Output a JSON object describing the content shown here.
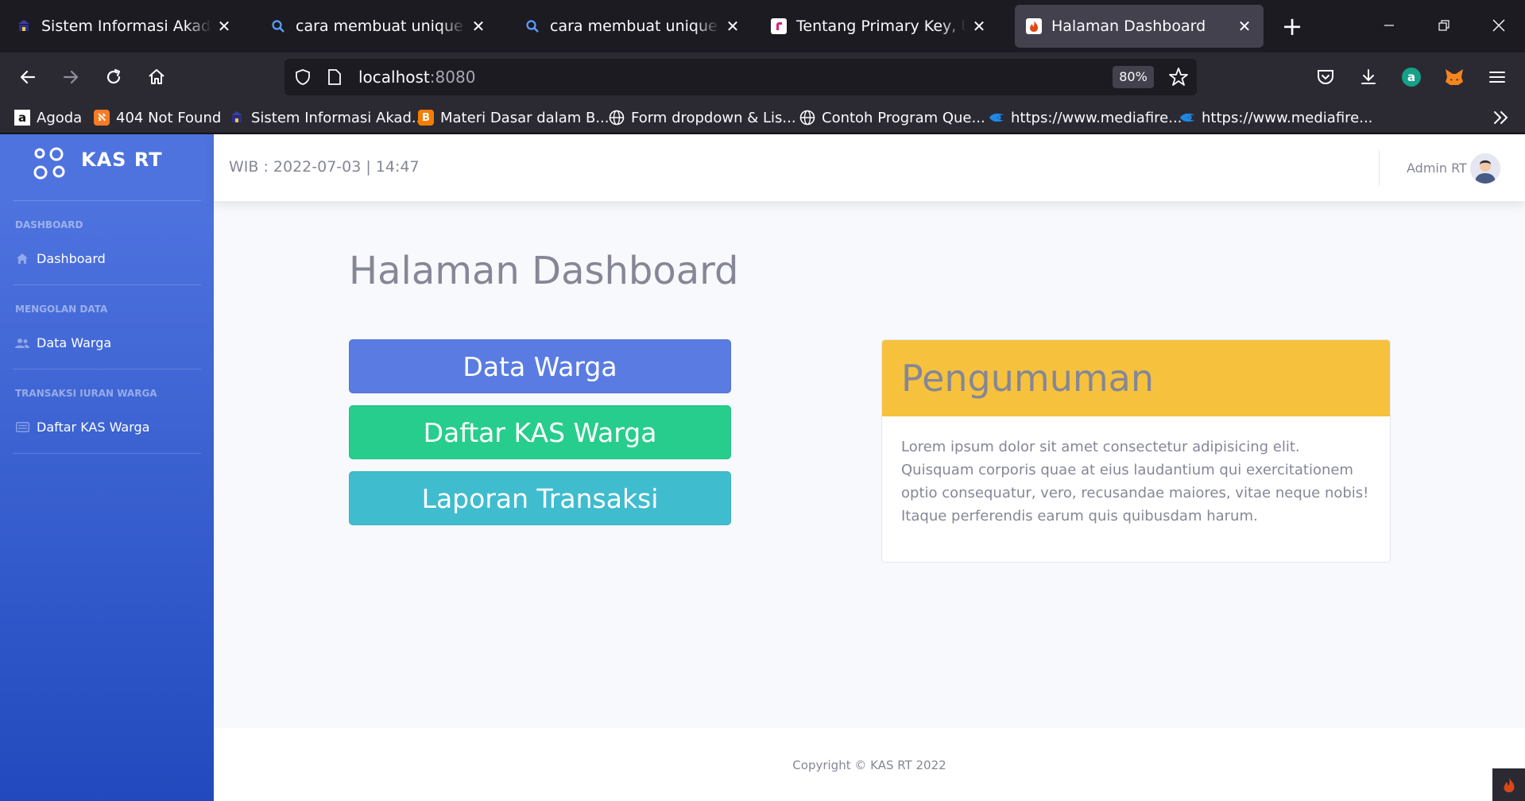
{
  "browser": {
    "tabs": [
      {
        "title": "Sistem Informasi Akademik",
        "icon": "campus-favicon",
        "active": false
      },
      {
        "title": "cara membuat unique di database",
        "icon": "search-icon",
        "active": false
      },
      {
        "title": "cara membuat unique di database",
        "icon": "search-icon",
        "active": false
      },
      {
        "title": "Tentang Primary Key, Unique Key",
        "icon": "r-favicon",
        "active": false
      },
      {
        "title": "Halaman Dashboard",
        "icon": "codeigniter-favicon",
        "active": true
      }
    ],
    "url_host": "localhost",
    "url_port": ":8080",
    "zoom": "80%",
    "bookmarks": [
      {
        "label": "Agoda",
        "icon": "amazon-favicon"
      },
      {
        "label": "404 Not Found",
        "icon": "xampp-favicon"
      },
      {
        "label": "Sistem Informasi Akad...",
        "icon": "campus-favicon"
      },
      {
        "label": "Materi Dasar dalam B...",
        "icon": "blogger-favicon"
      },
      {
        "label": "Form dropdown & Lis...",
        "icon": "globe-icon"
      },
      {
        "label": "Contoh Program Que...",
        "icon": "globe-icon"
      },
      {
        "label": "https://www.mediafire...",
        "icon": "mediafire-favicon"
      },
      {
        "label": "https://www.mediafire...",
        "icon": "mediafire-favicon"
      }
    ]
  },
  "sidebar": {
    "brand": "KAS RT",
    "sections": [
      {
        "heading": "DASHBOARD",
        "item": "Dashboard",
        "icon": "home-icon"
      },
      {
        "heading": "MENGOLAN DATA",
        "item": "Data Warga",
        "icon": "users-icon"
      },
      {
        "heading": "TRANSAKSI IURAN WARGA",
        "item": "Daftar KAS Warga",
        "icon": "list-icon"
      }
    ]
  },
  "topbar": {
    "clock": "WIB : 2022-07-03 | 14:47",
    "user": "Admin RT"
  },
  "main": {
    "title": "Halaman Dashboard",
    "buttons": [
      "Data Warga",
      "Daftar KAS Warga",
      "Laporan Transaksi"
    ],
    "announcement": {
      "title": "Pengumuman",
      "body": "Lorem ipsum dolor sit amet consectetur adipisicing elit. Quisquam corporis quae at eius laudantium qui exercitationem optio consequatur, vero, recusandae maiores, vitae neque nobis! Itaque perferendis earum quis quibusdam harum."
    }
  },
  "footer": {
    "copyright": "Copyright © KAS RT 2022"
  },
  "colors": {
    "sidebar_start": "#4e73df",
    "sidebar_end": "#224abe",
    "btn_primary": "#5a7ce2",
    "btn_success": "#27cd8c",
    "btn_info": "#40bccf",
    "announcement_header": "#f6c23e"
  }
}
